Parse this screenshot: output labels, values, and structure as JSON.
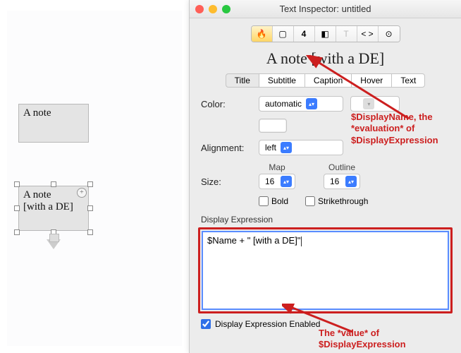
{
  "canvas": {
    "note_plain": "A note",
    "note_with_de_line1": "A note",
    "note_with_de_line2": "[with a DE]"
  },
  "window": {
    "title": "Text Inspector: untitled"
  },
  "toolbar": {
    "icons": [
      "flame",
      "page",
      "four",
      "shadow",
      "T",
      "code",
      "more"
    ],
    "glyphs": {
      "flame": "🔥",
      "page": "▢",
      "four": "4",
      "shadow": "◧",
      "T": "T",
      "code": "< >",
      "more": "⊙"
    }
  },
  "heading": "A note [with a DE]",
  "tabs": [
    "Title",
    "Subtitle",
    "Caption",
    "Hover",
    "Text"
  ],
  "selected_tab": "Title",
  "fields": {
    "color_label": "Color:",
    "color_value": "automatic",
    "alignment_label": "Alignment:",
    "alignment_value": "left",
    "map_label": "Map",
    "outline_label": "Outline",
    "size_label": "Size:",
    "size_map": "16",
    "size_outline": "16",
    "bold_label": "Bold",
    "strike_label": "Strikethrough"
  },
  "expression": {
    "section_label": "Display Expression",
    "value": "$Name + \" [with a DE]\"",
    "enabled_label": "Display Expression Enabled",
    "enabled": true
  },
  "annotations": {
    "top": "$DisplayName, the *evaluation* of $DisplayExpression",
    "bottom": "The *value* of $DisplayExpression"
  }
}
